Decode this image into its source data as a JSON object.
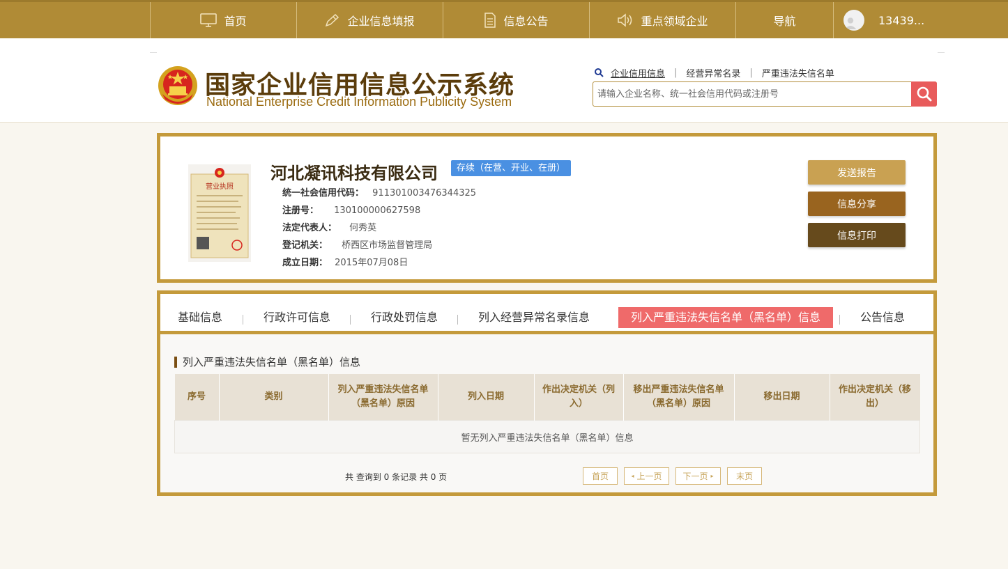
{
  "topnav": {
    "items": [
      {
        "label": "首页",
        "icon": "monitor-icon"
      },
      {
        "label": "企业信息填报",
        "icon": "edit-icon"
      },
      {
        "label": "信息公告",
        "icon": "document-icon"
      },
      {
        "label": "重点领域企业",
        "icon": "speaker-icon"
      },
      {
        "label": "导航"
      }
    ],
    "user": "13439..."
  },
  "header": {
    "title_cn": "国家企业信用信息公示系统",
    "title_en": "National Enterprise Credit Information Publicity System",
    "quick_links": [
      "企业信用信息",
      "经营异常名录",
      "严重违法失信名单"
    ],
    "search_placeholder": "请输入企业名称、统一社会信用代码或注册号"
  },
  "company": {
    "license_title": "营业执照",
    "name": "河北凝讯科技有限公司",
    "status": "存续（在营、开业、在册）",
    "fields": [
      {
        "label": "统一社会信用代码：",
        "value": "911301003476344325"
      },
      {
        "label": "注册号：",
        "value": "130100000627598"
      },
      {
        "label": "法定代表人：",
        "value": "何秀英"
      },
      {
        "label": "登记机关：",
        "value": "桥西区市场监督管理局"
      },
      {
        "label": "成立日期：",
        "value": "2015年07月08日"
      }
    ],
    "buttons": {
      "send_report": "发送报告",
      "share": "信息分享",
      "print": "信息打印"
    },
    "button_colors": {
      "send_report": "#c9a152",
      "share": "#99641f",
      "print": "#664a1c"
    }
  },
  "tabs": [
    "基础信息",
    "行政许可信息",
    "行政处罚信息",
    "列入经营异常名录信息",
    "列入严重违法失信名单（黑名单）信息",
    "公告信息"
  ],
  "section": {
    "title": "列入严重违法失信名单（黑名单）信息",
    "columns": [
      "序号",
      "类别",
      "列入严重违法失信名单（黑名单）原因",
      "列入日期",
      "作出决定机关（列入）",
      "移出严重违法失信名单（黑名单）原因",
      "移出日期",
      "作出决定机关（移出）"
    ],
    "empty_text": "暂无列入严重违法失信名单（黑名单）信息",
    "count_text": "共 查询到 0 条记录 共 0 页",
    "pager": {
      "first": "首页",
      "prev": "上一页",
      "next": "下一页",
      "last": "末页"
    }
  }
}
